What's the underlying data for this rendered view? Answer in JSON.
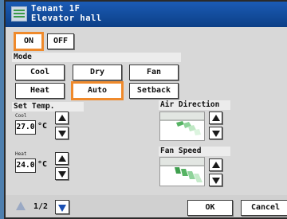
{
  "title": {
    "line1": "Tenant 1F",
    "line2": "Elevator hall"
  },
  "power": {
    "on_label": "ON",
    "off_label": "OFF",
    "selected": "ON"
  },
  "mode": {
    "header": "Mode",
    "buttons": [
      "Cool",
      "Dry",
      "Fan",
      "Heat",
      "Auto",
      "Setback"
    ],
    "selected": "Auto"
  },
  "set_temp": {
    "header": "Set Temp.",
    "cool": {
      "label": "Cool",
      "value": "27.0",
      "unit": "°C"
    },
    "heat": {
      "label": "Heat",
      "value": "24.0",
      "unit": "°C"
    }
  },
  "air_direction": {
    "header": "Air Direction",
    "icon": "louver-direction-icon"
  },
  "fan_speed": {
    "header": "Fan Speed",
    "icon": "fan-speed-icon"
  },
  "footer": {
    "page": "1/2",
    "ok_label": "OK",
    "cancel_label": "Cancel"
  },
  "colors": {
    "title_bg": "#0c3f86",
    "selected_outline": "#ef8a2c",
    "page_arrow": "#1a4fb3",
    "panel_bg": "#d8d8d8"
  }
}
